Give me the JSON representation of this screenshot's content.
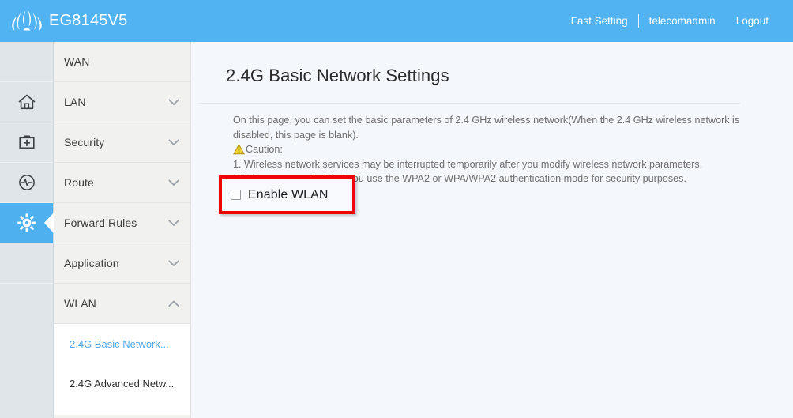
{
  "header": {
    "brand": "EG8145V5",
    "logo_icon": "huawei-flower-logo",
    "links": [
      {
        "label": "Fast Setting",
        "name": "fast-setting-link"
      },
      {
        "label": "telecomadmin",
        "name": "account-link"
      },
      {
        "label": "Logout",
        "name": "logout-link"
      }
    ]
  },
  "icon_rail": {
    "items": [
      {
        "icon": "home-icon",
        "name": "rail-item-home",
        "active": false
      },
      {
        "icon": "toolbox-icon",
        "name": "rail-item-maintenance",
        "active": false
      },
      {
        "icon": "gauge-icon",
        "name": "rail-item-status",
        "active": false
      },
      {
        "icon": "gear-icon",
        "name": "rail-item-settings",
        "active": true
      }
    ]
  },
  "menu": {
    "items": [
      {
        "label": "WAN",
        "chevron": "none"
      },
      {
        "label": "LAN",
        "chevron": "down"
      },
      {
        "label": "Security",
        "chevron": "down"
      },
      {
        "label": "Route",
        "chevron": "down"
      },
      {
        "label": "Forward Rules",
        "chevron": "down"
      },
      {
        "label": "Application",
        "chevron": "down"
      },
      {
        "label": "WLAN",
        "chevron": "up"
      }
    ],
    "submenu": [
      {
        "label": "2.4G Basic Network...",
        "active": true
      },
      {
        "label": "2.4G Advanced Netw...",
        "active": false
      }
    ]
  },
  "content": {
    "title": "2.4G Basic Network Settings",
    "description_line1": "On this page, you can set the basic parameters of 2.4 GHz wireless network(When the 2.4 GHz wireless network is",
    "description_line2": "disabled, this page is blank).",
    "caution_label": "Caution:",
    "caution_icon": "warning-triangle-icon",
    "caution_items": [
      "1. Wireless network services may be interrupted temporarily after you modify wireless network parameters.",
      "2. It is recommended that you use the WPA2 or WPA/WPA2 authentication mode for security purposes."
    ],
    "enable_wlan": {
      "label": "Enable WLAN",
      "checked": false,
      "highlight_color": "#f00000"
    }
  },
  "colors": {
    "header_blue": "#52b3f2",
    "accent_blue": "#4fb0ef",
    "link_blue": "#54a8e8",
    "rail_bg": "#dfe5e9",
    "menu_bg": "#f1f1f0",
    "content_bg": "#f4f7fc",
    "highlight_red": "#f00000",
    "warning_yellow": "#f2c230"
  }
}
